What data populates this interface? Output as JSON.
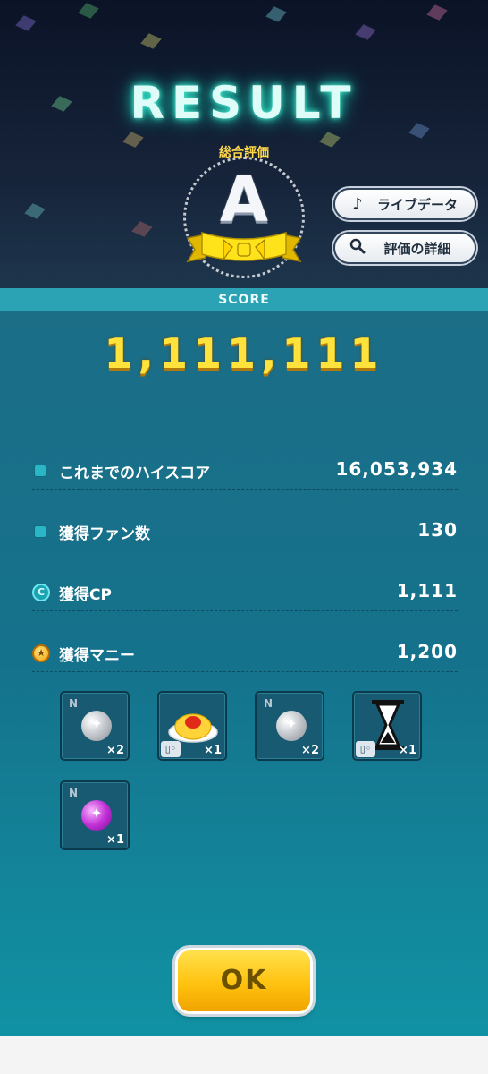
{
  "header": {
    "title": "RESULT",
    "grade_label": "総合評価",
    "grade": "A",
    "buttons": [
      {
        "label": "ライブデータ",
        "icon": "music-note-icon"
      },
      {
        "label": "評価の詳細",
        "icon": "magnifier-icon"
      }
    ]
  },
  "score": {
    "header": "SCORE",
    "value": "1,111,111"
  },
  "stats": [
    {
      "label": "これまでのハイスコア",
      "value": "16,053,934",
      "icon": "square-bullet-icon"
    },
    {
      "label": "獲得ファン数",
      "value": "130",
      "icon": "square-bullet-icon"
    },
    {
      "label": "獲得CP",
      "value": "1,111",
      "icon": "cp-coin-icon",
      "icon_text": "C"
    },
    {
      "label": "獲得マニー",
      "value": "1,200",
      "icon": "money-coin-icon",
      "icon_text": "★"
    }
  ],
  "rewards": [
    {
      "rank": "N",
      "qty": "×2",
      "icon": "silver-orb-icon"
    },
    {
      "rank": "",
      "qty": "×1",
      "icon": "omurice-icon"
    },
    {
      "rank": "N",
      "qty": "×2",
      "icon": "silver-orb-icon"
    },
    {
      "rank": "",
      "qty": "×1",
      "icon": "hourglass-icon"
    },
    {
      "rank": "N",
      "qty": "×1",
      "icon": "purple-orb-icon"
    }
  ],
  "ok_label": "OK",
  "colors": {
    "panel": "#15728c",
    "score_gold": "#ffe23b",
    "title_glow": "#4ff3d6",
    "ok_yellow": "#ffc20f"
  }
}
